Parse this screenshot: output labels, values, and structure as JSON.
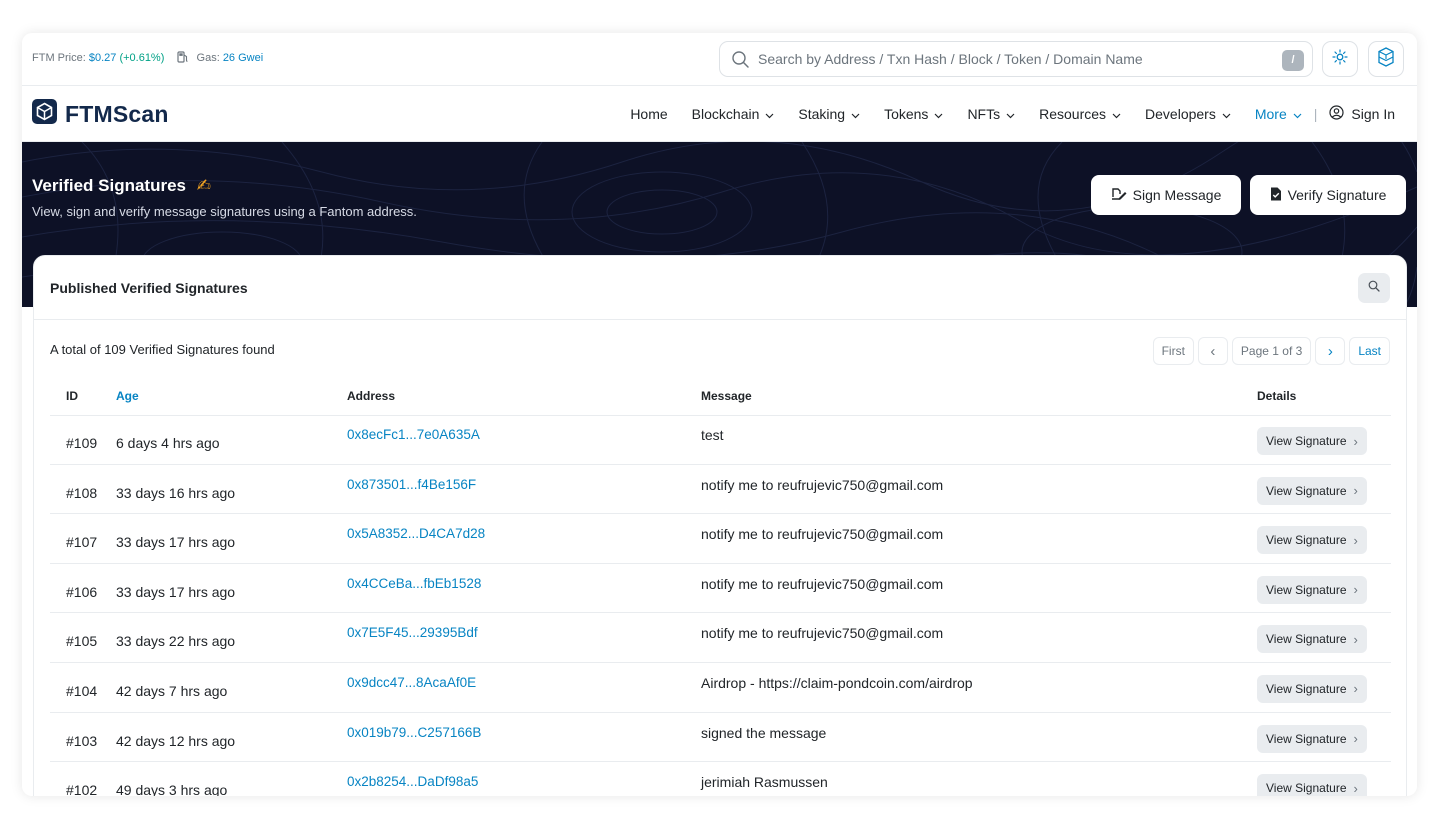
{
  "topbar": {
    "price_label": "FTM Price:",
    "price_value": "$0.27",
    "price_change": "(+0.61%)",
    "gas_label": "Gas:",
    "gas_value": "26 Gwei",
    "search_placeholder": "Search by Address / Txn Hash / Block / Token / Domain Name",
    "search_shortcut": "/"
  },
  "navbar": {
    "logo_text": "FTMScan",
    "items": [
      {
        "label": "Home",
        "dropdown": false
      },
      {
        "label": "Blockchain",
        "dropdown": true
      },
      {
        "label": "Staking",
        "dropdown": true
      },
      {
        "label": "Tokens",
        "dropdown": true
      },
      {
        "label": "NFTs",
        "dropdown": true
      },
      {
        "label": "Resources",
        "dropdown": true
      },
      {
        "label": "Developers",
        "dropdown": true
      },
      {
        "label": "More",
        "dropdown": true
      }
    ],
    "separator": "|",
    "sign_in": "Sign In"
  },
  "hero": {
    "title": "Verified Signatures",
    "title_emoji": "✍",
    "subtitle": "View, sign and verify message signatures using a Fantom address.",
    "sign_message_button": "Sign Message",
    "verify_signature_button": "Verify Signature"
  },
  "card": {
    "title": "Published Verified Signatures",
    "total_text": "A total of 109 Verified Signatures found",
    "pagination": {
      "first": "First",
      "prev": "‹",
      "page_info": "Page 1 of 3",
      "next": "›",
      "last": "Last"
    },
    "columns": {
      "id": "ID",
      "age": "Age",
      "address": "Address",
      "message": "Message",
      "details": "Details"
    },
    "view_button_label": "View Signature",
    "rows": [
      {
        "id": "#109",
        "age": "6 days 4 hrs ago",
        "address": "0x8ecFc1...7e0A635A",
        "message": "test"
      },
      {
        "id": "#108",
        "age": "33 days 16 hrs ago",
        "address": "0x873501...f4Be156F",
        "message": "notify me to reufrujevic750@gmail.com"
      },
      {
        "id": "#107",
        "age": "33 days 17 hrs ago",
        "address": "0x5A8352...D4CA7d28",
        "message": "notify me to reufrujevic750@gmail.com"
      },
      {
        "id": "#106",
        "age": "33 days 17 hrs ago",
        "address": "0x4CCeBa...fbEb1528",
        "message": "notify me to reufrujevic750@gmail.com"
      },
      {
        "id": "#105",
        "age": "33 days 22 hrs ago",
        "address": "0x7E5F45...29395Bdf",
        "message": "notify me to reufrujevic750@gmail.com"
      },
      {
        "id": "#104",
        "age": "42 days 7 hrs ago",
        "address": "0x9dcc47...8AcaAf0E",
        "message": "Airdrop - https://claim-pondcoin.com/airdrop"
      },
      {
        "id": "#103",
        "age": "42 days 12 hrs ago",
        "address": "0x019b79...C257166B",
        "message": "signed the message"
      },
      {
        "id": "#102",
        "age": "49 days 3 hrs ago",
        "address": "0x2b8254...DaDf98a5",
        "message": "jerimiah Rasmussen"
      }
    ]
  },
  "colors": {
    "link_blue": "#0784c3",
    "positive_green": "#00a186",
    "hero_bg": "#0d1126",
    "logo_navy": "#13294b"
  }
}
